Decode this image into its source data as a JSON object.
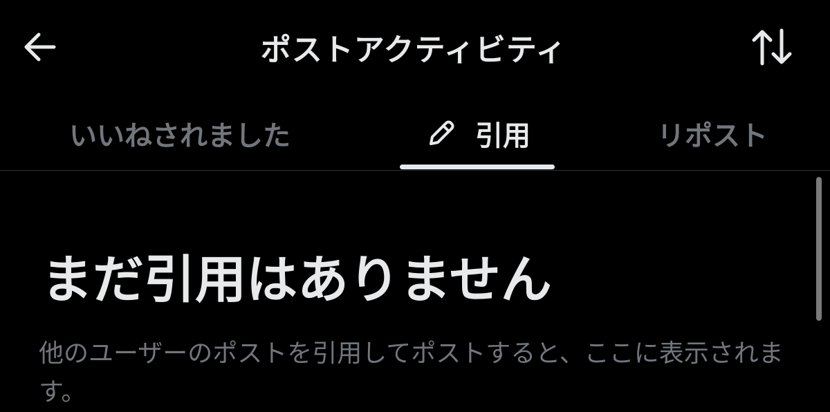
{
  "header": {
    "title": "ポストアクティビティ",
    "back_icon": "arrow-left-icon",
    "sort_icon": "sort-arrows-icon"
  },
  "tabs": [
    {
      "label": "いいねされました",
      "active": false
    },
    {
      "label": "引用",
      "active": true,
      "icon": "pencil-icon"
    },
    {
      "label": "リポスト",
      "active": false
    }
  ],
  "empty_state": {
    "title": "まだ引用はありません",
    "description": "他のユーザーのポストを引用してポストすると、ここに表示されます。"
  },
  "colors": {
    "background": "#000000",
    "primary_text": "#e7e9ea",
    "secondary_text": "#71767b",
    "divider": "#2f3336"
  }
}
